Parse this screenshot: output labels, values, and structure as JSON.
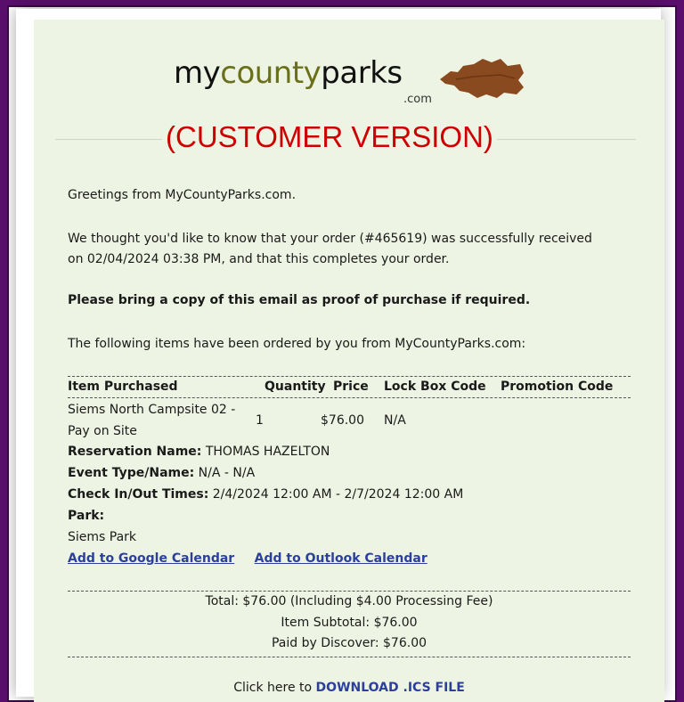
{
  "logo": {
    "my": "my",
    "county": "county",
    "parks": "parks",
    "com": ".com"
  },
  "banner": "(CUSTOMER VERSION)",
  "greeting": "Greetings from MyCountyParks.com.",
  "order_line_1": "We thought you'd like to know that your order (#465619) was successfully received",
  "order_line_2": "on 02/04/2024 03:38 PM, and that this completes your order.",
  "proof_notice": "Please bring a copy of this email as proof of purchase if required.",
  "items_intro": "The following items have been ordered by you from MyCountyParks.com:",
  "table": {
    "headers": [
      "Item Purchased",
      "Quantity",
      "Price",
      "Lock Box Code",
      "Promotion Code"
    ],
    "row": {
      "item_line_1": "Siems North Campsite 02 -",
      "item_line_2": "Pay on Site",
      "quantity": "1",
      "price": "$76.00",
      "lock_box_code": "N/A"
    }
  },
  "details": {
    "reservation_label": "Reservation Name:",
    "reservation_value": "THOMAS HAZELTON",
    "event_label": "Event Type/Name:",
    "event_value": "N/A - N/A",
    "checkin_label": "Check In/Out Times:",
    "checkin_value": "2/4/2024 12:00 AM - 2/7/2024 12:00 AM",
    "park_label": "Park:",
    "park_value": "Siems Park"
  },
  "links": {
    "google_calendar": "Add to Google Calendar",
    "outlook_calendar": "Add to Outlook Calendar"
  },
  "totals": {
    "total": "Total: $76.00 (Including $4.00 Processing Fee)",
    "subtotal": "Item Subtotal: $76.00",
    "paid": "Paid by Discover: $76.00"
  },
  "download": {
    "prefix": "Click here to",
    "link": "DOWNLOAD .ICS FILE"
  },
  "colors": {
    "background": "#5a0f6d",
    "card": "#eef4e3",
    "banner": "#cc0000",
    "link": "#2b3f9c",
    "logo_accent": "#6a6f19",
    "arrowhead": "#8a4a1f"
  }
}
